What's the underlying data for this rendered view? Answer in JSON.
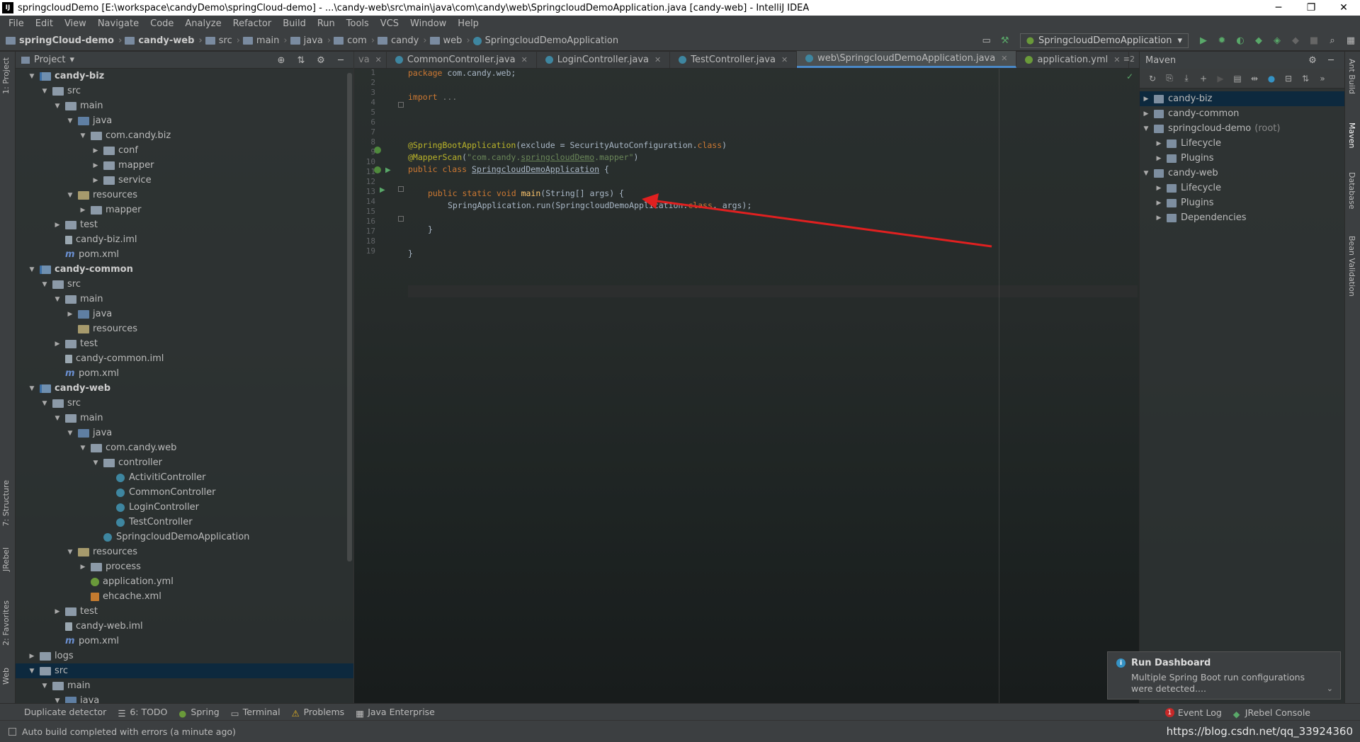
{
  "window": {
    "title": "springcloudDemo [E:\\workspace\\candyDemo\\springCloud-demo] - ...\\candy-web\\src\\main\\java\\com\\candy\\web\\SpringcloudDemoApplication.java [candy-web] - IntelliJ IDEA",
    "minimize": "─",
    "maximize": "❐",
    "close": "✕"
  },
  "menu": [
    "File",
    "Edit",
    "View",
    "Navigate",
    "Code",
    "Analyze",
    "Refactor",
    "Build",
    "Run",
    "Tools",
    "VCS",
    "Window",
    "Help"
  ],
  "breadcrumb": [
    "springCloud-demo",
    "candy-web",
    "src",
    "main",
    "java",
    "com",
    "candy",
    "web",
    "SpringcloudDemoApplication"
  ],
  "run_config": "SpringcloudDemoApplication",
  "left_strip": {
    "project": "1: Project",
    "structure": "7: Structure",
    "jrebel": "JRebel",
    "favorites": "2: Favorites",
    "web": "Web"
  },
  "project_panel": {
    "title": "Project",
    "dropdown": "▾",
    "tree": [
      {
        "label": "candy-biz",
        "depth": 0,
        "arrow": "▼",
        "icon": "mod",
        "bold": true
      },
      {
        "label": "src",
        "depth": 1,
        "arrow": "▼",
        "icon": "folder"
      },
      {
        "label": "main",
        "depth": 2,
        "arrow": "▼",
        "icon": "folder"
      },
      {
        "label": "java",
        "depth": 3,
        "arrow": "▼",
        "icon": "srcf"
      },
      {
        "label": "com.candy.biz",
        "depth": 4,
        "arrow": "▼",
        "icon": "folder"
      },
      {
        "label": "conf",
        "depth": 5,
        "arrow": "▶",
        "icon": "folder"
      },
      {
        "label": "mapper",
        "depth": 5,
        "arrow": "▶",
        "icon": "folder"
      },
      {
        "label": "service",
        "depth": 5,
        "arrow": "▶",
        "icon": "folder"
      },
      {
        "label": "resources",
        "depth": 3,
        "arrow": "▼",
        "icon": "resf"
      },
      {
        "label": "mapper",
        "depth": 4,
        "arrow": "▶",
        "icon": "folder"
      },
      {
        "label": "test",
        "depth": 2,
        "arrow": "▶",
        "icon": "folder"
      },
      {
        "label": "candy-biz.iml",
        "depth": 2,
        "arrow": "",
        "icon": "iml"
      },
      {
        "label": "pom.xml",
        "depth": 2,
        "arrow": "",
        "icon": "pom"
      },
      {
        "label": "candy-common",
        "depth": 0,
        "arrow": "▼",
        "icon": "mod",
        "bold": true
      },
      {
        "label": "src",
        "depth": 1,
        "arrow": "▼",
        "icon": "folder"
      },
      {
        "label": "main",
        "depth": 2,
        "arrow": "▼",
        "icon": "folder"
      },
      {
        "label": "java",
        "depth": 3,
        "arrow": "▶",
        "icon": "srcf"
      },
      {
        "label": "resources",
        "depth": 3,
        "arrow": "",
        "icon": "resf"
      },
      {
        "label": "test",
        "depth": 2,
        "arrow": "▶",
        "icon": "folder"
      },
      {
        "label": "candy-common.iml",
        "depth": 2,
        "arrow": "",
        "icon": "iml"
      },
      {
        "label": "pom.xml",
        "depth": 2,
        "arrow": "",
        "icon": "pom"
      },
      {
        "label": "candy-web",
        "depth": 0,
        "arrow": "▼",
        "icon": "mod",
        "bold": true
      },
      {
        "label": "src",
        "depth": 1,
        "arrow": "▼",
        "icon": "folder"
      },
      {
        "label": "main",
        "depth": 2,
        "arrow": "▼",
        "icon": "folder"
      },
      {
        "label": "java",
        "depth": 3,
        "arrow": "▼",
        "icon": "srcf"
      },
      {
        "label": "com.candy.web",
        "depth": 4,
        "arrow": "▼",
        "icon": "folder"
      },
      {
        "label": "controller",
        "depth": 5,
        "arrow": "▼",
        "icon": "folder"
      },
      {
        "label": "ActivitiController",
        "depth": 6,
        "arrow": "",
        "icon": "cls"
      },
      {
        "label": "CommonController",
        "depth": 6,
        "arrow": "",
        "icon": "cls"
      },
      {
        "label": "LoginController",
        "depth": 6,
        "arrow": "",
        "icon": "cls"
      },
      {
        "label": "TestController",
        "depth": 6,
        "arrow": "",
        "icon": "cls"
      },
      {
        "label": "SpringcloudDemoApplication",
        "depth": 5,
        "arrow": "",
        "icon": "cls"
      },
      {
        "label": "resources",
        "depth": 3,
        "arrow": "▼",
        "icon": "resf"
      },
      {
        "label": "process",
        "depth": 4,
        "arrow": "▶",
        "icon": "folder"
      },
      {
        "label": "application.yml",
        "depth": 4,
        "arrow": "",
        "icon": "yml"
      },
      {
        "label": "ehcache.xml",
        "depth": 4,
        "arrow": "",
        "icon": "xml"
      },
      {
        "label": "test",
        "depth": 2,
        "arrow": "▶",
        "icon": "folder"
      },
      {
        "label": "candy-web.iml",
        "depth": 2,
        "arrow": "",
        "icon": "iml"
      },
      {
        "label": "pom.xml",
        "depth": 2,
        "arrow": "",
        "icon": "pom"
      },
      {
        "label": "logs",
        "depth": 0,
        "arrow": "▶",
        "icon": "folder"
      },
      {
        "label": "src",
        "depth": 0,
        "arrow": "▼",
        "icon": "folder",
        "selected": true
      },
      {
        "label": "main",
        "depth": 1,
        "arrow": "▼",
        "icon": "folder"
      },
      {
        "label": "java",
        "depth": 2,
        "arrow": "▼",
        "icon": "srcf"
      }
    ]
  },
  "tabs": [
    {
      "label": "CommonController.java",
      "active": false
    },
    {
      "label": "LoginController.java",
      "active": false
    },
    {
      "label": "TestController.java",
      "active": false
    },
    {
      "label": "web\\SpringcloudDemoApplication.java",
      "active": true
    },
    {
      "label": "application.yml",
      "active": false
    }
  ],
  "tab_prefix": "va",
  "tab_menu": "≡2",
  "code": {
    "line_numbers": [
      "1",
      "2",
      "3",
      "4",
      "5",
      "6",
      "7",
      "8",
      "9",
      "10",
      "11",
      "12",
      "13",
      "14",
      "15",
      "16",
      "17",
      "18",
      "19"
    ],
    "line1": {
      "kw": "package",
      "rest": " com.candy.web;"
    },
    "line3": {
      "kw": "import",
      "rest": " ..."
    },
    "line9": {
      "ann": "@SpringBootApplication",
      "p1": "(exclude = SecurityAutoConfiguration.",
      "kw": "class",
      "p2": ")"
    },
    "line10": {
      "ann": "@MapperScan",
      "p1": "(",
      "s1": "\"com.candy.",
      "s2": "springcloudDemo",
      "s3": ".mapper\"",
      "p2": ")"
    },
    "line11": {
      "kw": "public class",
      "name": "SpringcloudDemoApplication",
      "rest": " {"
    },
    "line13": {
      "kw": "public static void",
      "fn": "main",
      "rest": "(String[] args) {"
    },
    "line14": {
      "p1": "SpringApplication.run(SpringcloudDemoApplication.",
      "kw": "class",
      "p2": ", args);"
    },
    "line16": "}",
    "line18": "}"
  },
  "maven": {
    "title": "Maven",
    "items": [
      {
        "label": "candy-biz",
        "depth": 0,
        "arrow": "▶",
        "selected": true
      },
      {
        "label": "candy-common",
        "depth": 0,
        "arrow": "▶"
      },
      {
        "label": "springcloud-demo",
        "suffix": "(root)",
        "depth": 0,
        "arrow": "▼"
      },
      {
        "label": "Lifecycle",
        "depth": 1,
        "arrow": "▶"
      },
      {
        "label": "Plugins",
        "depth": 1,
        "arrow": "▶"
      },
      {
        "label": "candy-web",
        "depth": 0,
        "arrow": "▼"
      },
      {
        "label": "Lifecycle",
        "depth": 1,
        "arrow": "▶"
      },
      {
        "label": "Plugins",
        "depth": 1,
        "arrow": "▶"
      },
      {
        "label": "Dependencies",
        "depth": 1,
        "arrow": "▶"
      }
    ]
  },
  "right_strip": {
    "ant": "Ant Build",
    "maven": "Maven",
    "database": "Database",
    "bean": "Bean Validation"
  },
  "notification": {
    "title": "Run Dashboard",
    "body": "Multiple Spring Boot run configurations were detected....",
    "chevron": "⌄"
  },
  "bottom_tools": [
    {
      "label": "Duplicate detector",
      "icon": "none"
    },
    {
      "label": "6: TODO",
      "icon": "list"
    },
    {
      "label": "Spring",
      "icon": "spring"
    },
    {
      "label": "Terminal",
      "icon": "terminal"
    },
    {
      "label": "Problems",
      "icon": "warning"
    },
    {
      "label": "Java Enterprise",
      "icon": "je"
    }
  ],
  "bottom_right": {
    "event_count": "1",
    "event_log": "Event Log",
    "jrebel": "JRebel Console"
  },
  "status": {
    "message": "Auto build completed with errors (a minute ago)",
    "watermark": "https://blog.csdn.net/qq_33924360"
  }
}
